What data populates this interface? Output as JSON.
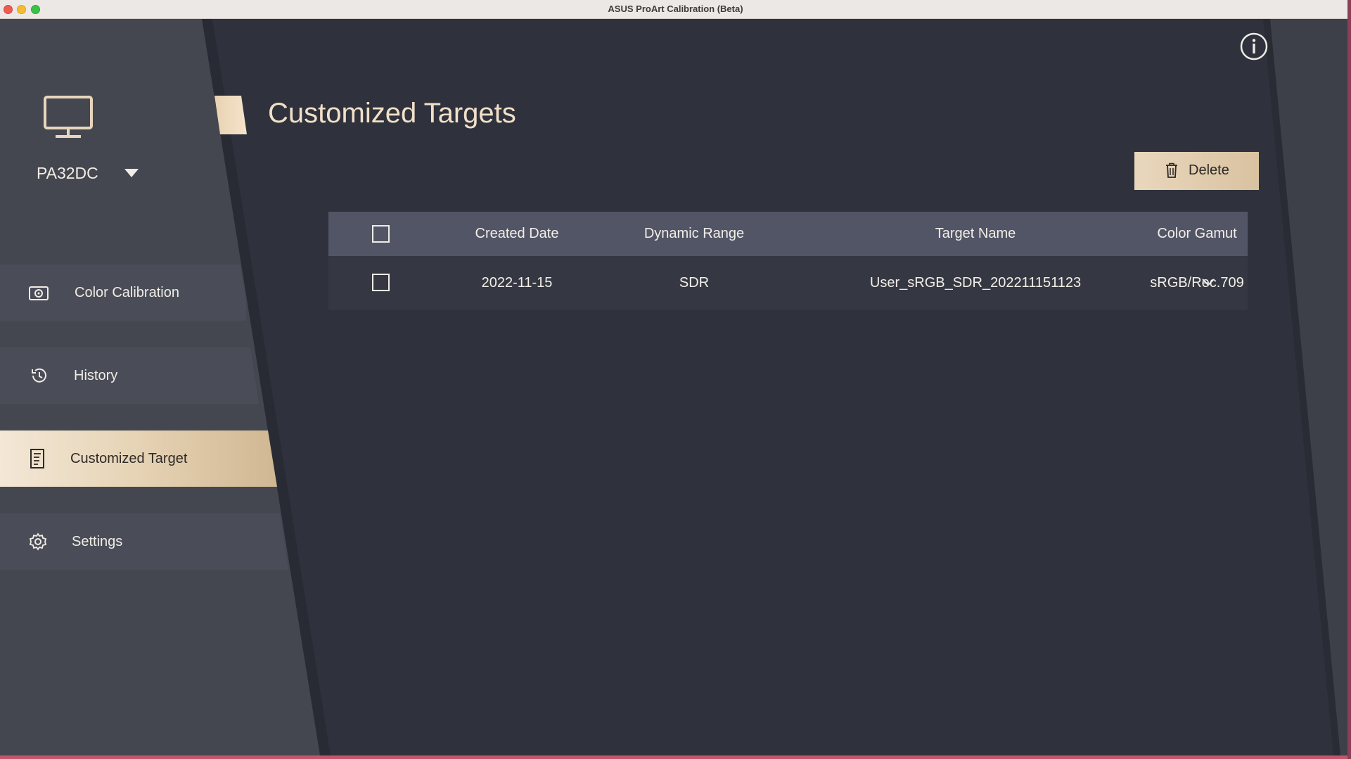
{
  "window": {
    "title": "ASUS ProArt Calibration (Beta)"
  },
  "device": {
    "name": "PA32DC"
  },
  "sidebar": {
    "items": [
      {
        "label": "Color Calibration",
        "icon": "camera-icon",
        "active": false
      },
      {
        "label": "History",
        "icon": "history-icon",
        "active": false
      },
      {
        "label": "Customized Target",
        "icon": "document-icon",
        "active": true
      },
      {
        "label": "Settings",
        "icon": "gear-icon",
        "active": false
      }
    ]
  },
  "main": {
    "title": "Customized Targets",
    "delete_label": "Delete",
    "table": {
      "columns": [
        "Created Date",
        "Dynamic Range",
        "Target Name",
        "Color Gamut"
      ],
      "rows": [
        {
          "checked": false,
          "created_date": "2022-11-15",
          "dynamic_range": "SDR",
          "target_name": "User_sRGB_SDR_202211151123",
          "color_gamut": "sRGB/Rec.709"
        }
      ]
    }
  },
  "colors": {
    "accent": "#e6d3b5",
    "background": "#2f323c",
    "sidebar": "#444750",
    "title": "#f1e0c8"
  }
}
